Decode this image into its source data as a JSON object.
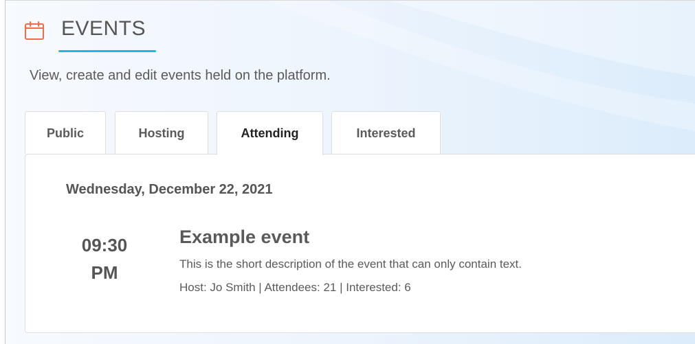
{
  "header": {
    "title": "EVENTS",
    "icon": "calendar-icon",
    "accent_color": "#1fb6ea",
    "icon_color": "#f26a4b"
  },
  "subtitle": "View, create and edit events held on the platform.",
  "tabs": [
    {
      "label": "Public",
      "active": false
    },
    {
      "label": "Hosting",
      "active": false
    },
    {
      "label": "Attending",
      "active": true
    },
    {
      "label": "Interested",
      "active": false
    }
  ],
  "events": {
    "date_heading": "Wednesday, December 22, 2021",
    "items": [
      {
        "time_hm": "09:30",
        "time_ampm": "PM",
        "title": "Example event",
        "description": "This is the short description of the event that can only contain text.",
        "meta": "Host: Jo Smith | Attendees: 21 | Interested: 6"
      }
    ]
  }
}
